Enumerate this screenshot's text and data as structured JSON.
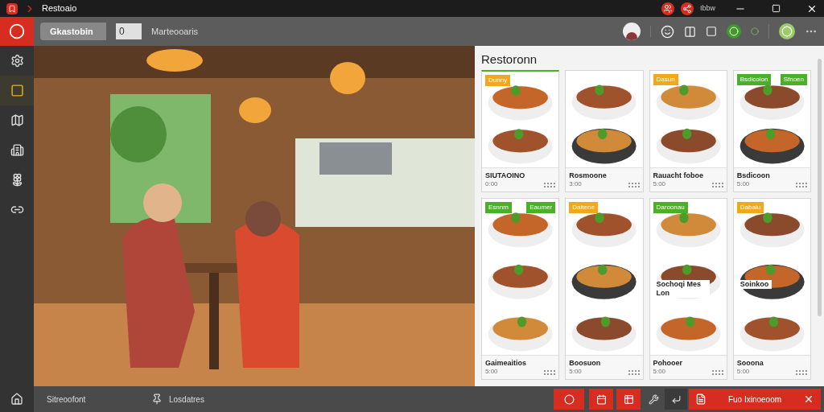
{
  "window": {
    "title": "Restoaio",
    "status": "Ibbw"
  },
  "toolbar": {
    "breadcrumb": "Gkastobin",
    "field_value": "0",
    "label": "Marteooaris"
  },
  "sidebar": {
    "items": [
      {
        "selected": false
      },
      {
        "selected": true
      },
      {
        "selected": false
      },
      {
        "selected": false
      },
      {
        "selected": false
      },
      {
        "selected": false
      }
    ]
  },
  "menu": {
    "title": "Restoronn",
    "cards": [
      {
        "name": "SIUTAOINO",
        "price": "0:00",
        "tags": [
          {
            "label": "Dunny",
            "color": "#f0a81c"
          }
        ]
      },
      {
        "name": "Rosmoone",
        "price": "3:00"
      },
      {
        "name": "Rauacht foboe",
        "price": "5:00",
        "tags": [
          {
            "label": "Dasun",
            "color": "#f0a81c"
          }
        ]
      },
      {
        "name": "Bsdicoon",
        "price": "5:00",
        "tags": [
          {
            "label": "Bsdicoion",
            "color": "#4caf2a"
          },
          {
            "label": "Sfnoen",
            "color": "#4caf2a"
          }
        ]
      },
      {
        "name": "Gaimeaitios",
        "price": "5:00",
        "tags": [
          {
            "label": "Esnnm",
            "color": "#4caf2a"
          },
          {
            "label": "Eaumer",
            "color": "#4caf2a"
          }
        ]
      },
      {
        "name": "Boosuon",
        "price": "5:00",
        "tags": [
          {
            "label": "Daitene",
            "color": "#f0a81c"
          }
        ]
      },
      {
        "name": "Pohooer",
        "price": "5:00",
        "note": "Sochoqi Mes Lon",
        "tags": [
          {
            "label": "Daroonau",
            "color": "#4caf2a"
          }
        ]
      },
      {
        "name": "Sooona",
        "price": "5:00",
        "note": "Soinkoo",
        "tags": [
          {
            "label": "Dabaiu",
            "color": "#f0a81c"
          }
        ]
      }
    ]
  },
  "bottom_bar": {
    "left_label": "Sitreoofont",
    "right_label": "Losdatres",
    "action": "Fuo Ixinoeoom"
  }
}
